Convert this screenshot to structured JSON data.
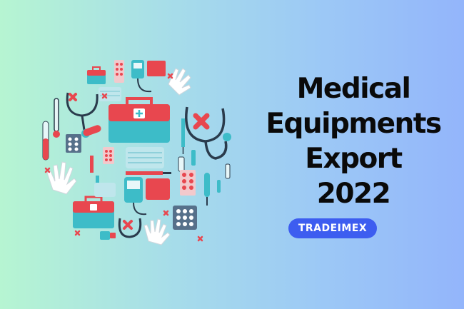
{
  "headline": {
    "line1": "Medical",
    "line2": "Equipments",
    "line3": "Export",
    "line4": "2022"
  },
  "brand_label": "TRADEIMEX",
  "colors": {
    "gradient_left": "#b6f5d2",
    "gradient_right": "#93b5fb",
    "title_text": "#0a0a0a",
    "badge_bg": "#3d5df0",
    "badge_text": "#ffffff",
    "accent_red": "#e8474f",
    "accent_teal": "#3dbcc8"
  },
  "illustration": {
    "icons": [
      "first-aid-kit-icon",
      "stethoscope-icon",
      "pill-blister-icon",
      "syringe-icon",
      "thermometer-icon",
      "glove-icon",
      "face-mask-icon",
      "blood-pressure-monitor-icon",
      "test-tube-icon",
      "vial-icon",
      "bandage-icon",
      "cross-mark-icon"
    ]
  }
}
